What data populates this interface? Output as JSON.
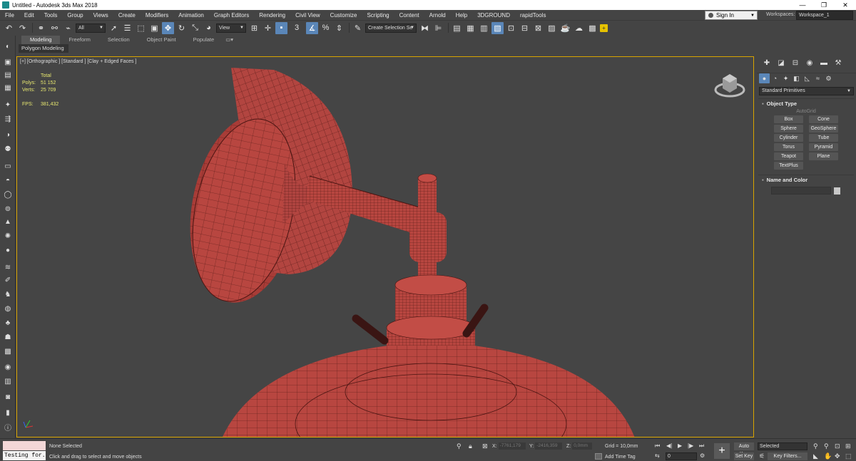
{
  "title_bar": {
    "title": "Untitled - Autodesk 3ds Max 2018",
    "buttons": [
      "—",
      "❐",
      "✕"
    ]
  },
  "menu": {
    "items": [
      "File",
      "Edit",
      "Tools",
      "Group",
      "Views",
      "Create",
      "Modifiers",
      "Animation",
      "Graph Editors",
      "Rendering",
      "Civil View",
      "Customize",
      "Scripting",
      "Content",
      "Arnold",
      "Help",
      "3DGROUND",
      "rapidTools"
    ],
    "sign_in": "Sign In",
    "workspaces_label": "Workspaces:",
    "workspace_value": "Workspace_1"
  },
  "toolbar": {
    "filter_value": "All",
    "refcoord_value": "View",
    "named_selection_value": "Create Selection Se",
    "snap_angle_icon": "3",
    "percent_snap_icon": "%"
  },
  "ribbon": {
    "tabs": [
      "Modeling",
      "Freeform",
      "Selection",
      "Object Paint",
      "Populate"
    ],
    "sub_label": "Polygon Modeling"
  },
  "viewport": {
    "label": "[+] [Orthographic ] [Standard ] [Clay + Edged Faces ]",
    "stats": {
      "header": "Total",
      "polys_label": "Polys:",
      "polys_value": "51 152",
      "verts_label": "Verts:",
      "verts_value": "25 709",
      "fps_label": "FPS:",
      "fps_value": "381,432"
    }
  },
  "command_panel": {
    "category": "Standard Primitives",
    "object_type_title": "Object Type",
    "autogrid": "AutoGrid",
    "object_types": [
      "Box",
      "Cone",
      "Sphere",
      "GeoSphere",
      "Cylinder",
      "Tube",
      "Torus",
      "Pyramid",
      "Teapot",
      "Plane",
      "TextPlus"
    ],
    "name_color_title": "Name and Color"
  },
  "status": {
    "maxscript_text": "Testing for.",
    "selection_status": "None Selected",
    "prompt": "Click and drag to select and move objects",
    "x_label": "X:",
    "x_value": "-7761,179",
    "y_label": "Y:",
    "y_value": "-2416,359",
    "z_label": "Z:",
    "z_value": "0,0mm",
    "grid": "Grid = 10,0mm",
    "add_time_tag": "Add Time Tag",
    "frame_value": "0",
    "auto_key": "Auto Key",
    "set_key": "Set Key",
    "selected_dropdown": "Selected",
    "key_filters": "Key Filters..."
  },
  "colors": {
    "model_red": "#b84640",
    "wire": "#4a1512",
    "viewport_bg": "#454545",
    "active_border": "#d9a400",
    "accent_blue": "#5a86b8",
    "stats_yellow": "#e8e870"
  }
}
